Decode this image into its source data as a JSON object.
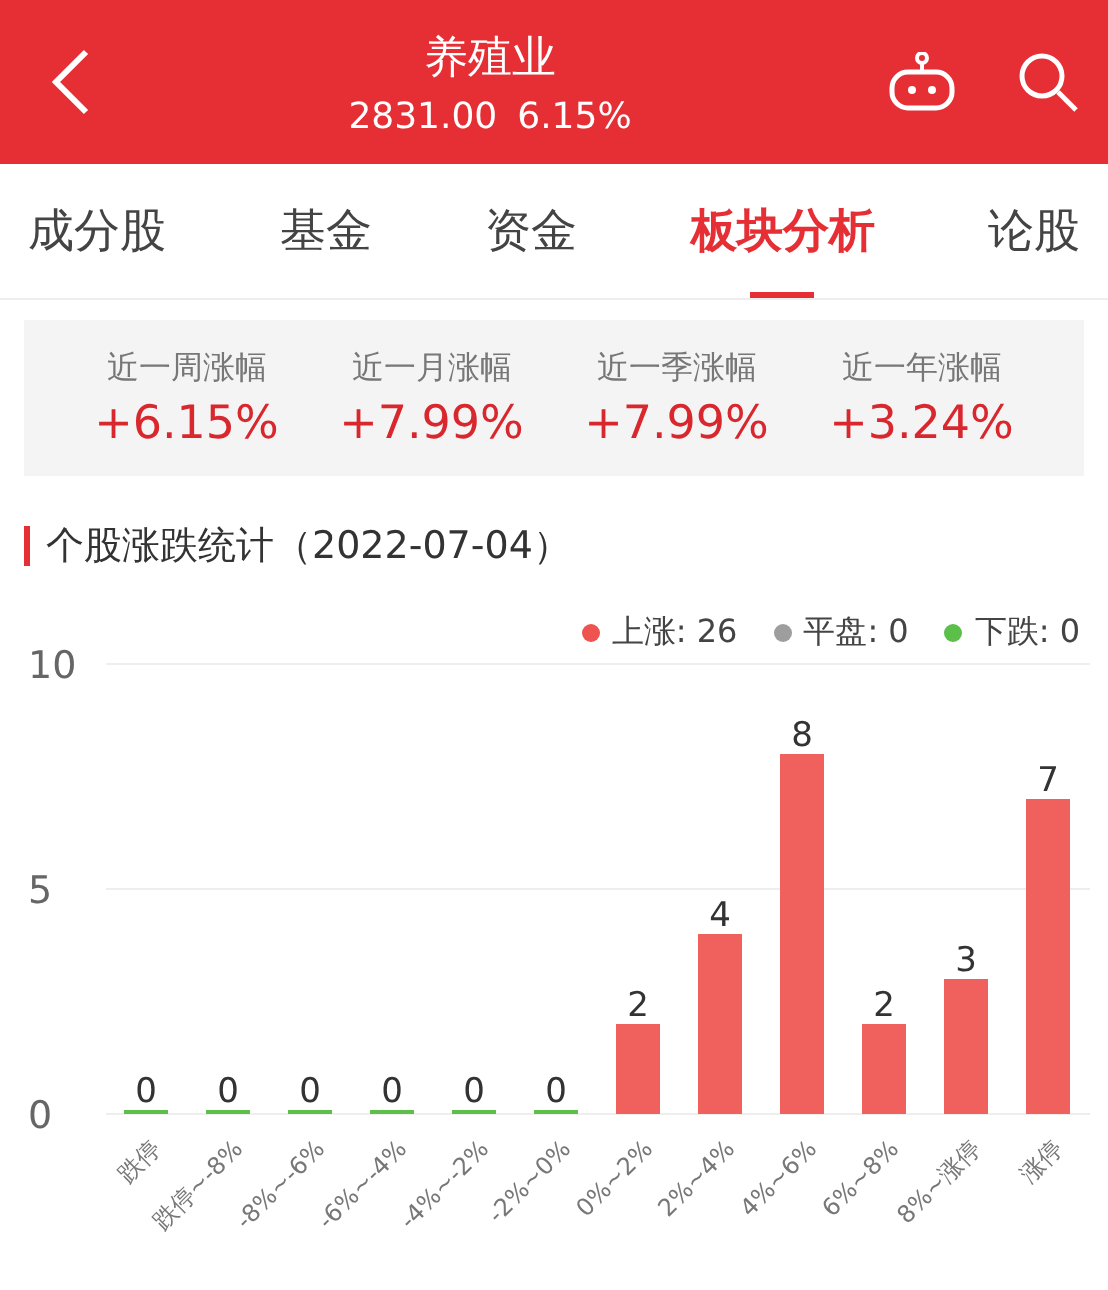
{
  "header": {
    "title": "养殖业",
    "price": "2831.00",
    "change": "6.15%"
  },
  "tabs": [
    {
      "label": "成分股",
      "selected": false
    },
    {
      "label": "基金",
      "selected": false
    },
    {
      "label": "资金",
      "selected": false
    },
    {
      "label": "板块分析",
      "selected": true
    },
    {
      "label": "论股",
      "selected": false
    }
  ],
  "stats": [
    {
      "label": "近一周涨幅",
      "value": "+6.15%"
    },
    {
      "label": "近一月涨幅",
      "value": "+7.99%"
    },
    {
      "label": "近一季涨幅",
      "value": "+7.99%"
    },
    {
      "label": "近一年涨幅",
      "value": "+3.24%"
    }
  ],
  "section": {
    "title": "个股涨跌统计（2022-07-04）"
  },
  "legend": [
    {
      "label": "上涨: 26",
      "color": "#ef5350"
    },
    {
      "label": "平盘: 0",
      "color": "#9e9e9e"
    },
    {
      "label": "下跌: 0",
      "color": "#5cbf4a"
    }
  ],
  "chart_data": {
    "type": "bar",
    "categories": [
      "跌停",
      "跌停~-8%",
      "-8%~-6%",
      "-6%~-4%",
      "-4%~-2%",
      "-2%~0%",
      "0%~2%",
      "2%~4%",
      "4%~6%",
      "6%~8%",
      "8%~涨停",
      "涨停"
    ],
    "series": [
      {
        "color": "#f0605d",
        "values": [
          null,
          null,
          null,
          null,
          null,
          null,
          2,
          4,
          8,
          2,
          3,
          7
        ]
      },
      {
        "color": "#5cbf4a",
        "values": [
          0,
          0,
          0,
          0,
          0,
          0,
          null,
          null,
          null,
          null,
          null,
          null
        ]
      }
    ],
    "ylim": [
      0,
      10
    ],
    "yticks": [
      0,
      5,
      10
    ],
    "data_labels": true
  }
}
